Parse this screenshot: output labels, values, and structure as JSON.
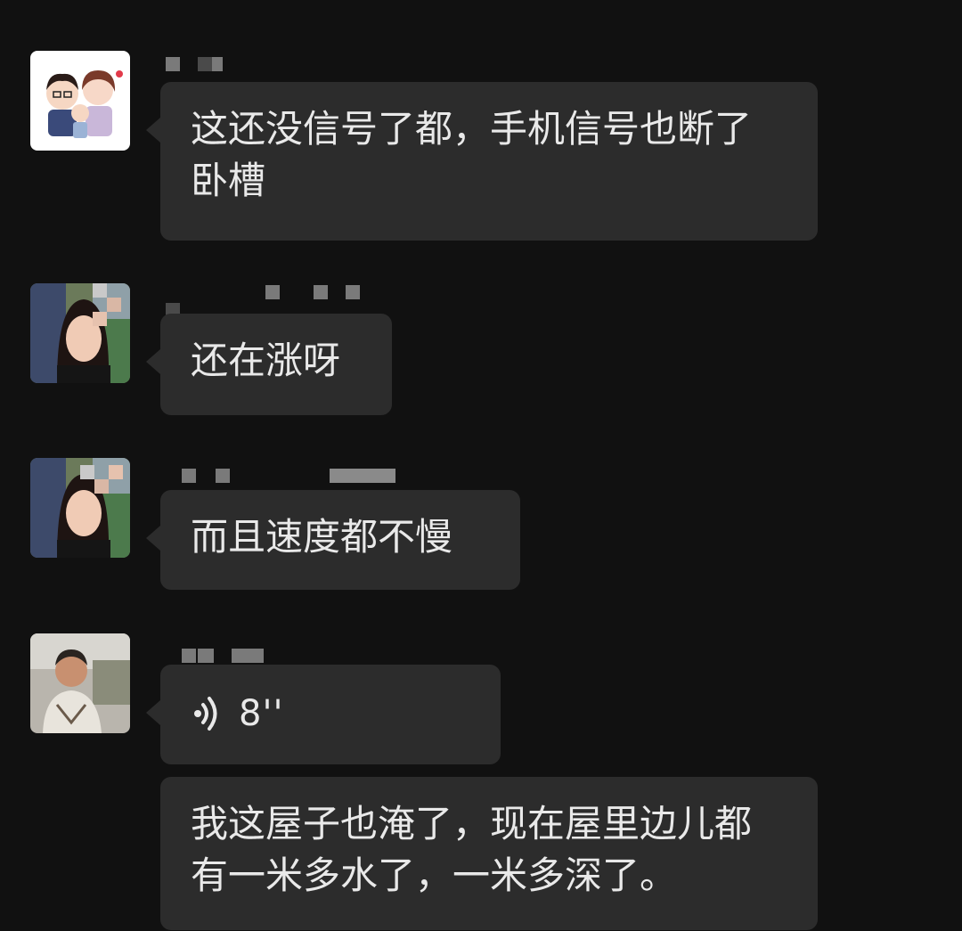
{
  "messages": [
    {
      "type": "text",
      "text": "这还没信号了都，手机信号也断了卧槽",
      "avatar": "cartoon-couple-avatar"
    },
    {
      "type": "text",
      "text": "还在涨呀",
      "avatar": "woman-photo-avatar"
    },
    {
      "type": "text",
      "text": "而且速度都不慢",
      "avatar": "woman-photo-avatar"
    },
    {
      "type": "voice",
      "duration": "8''",
      "avatar": "man-photo-avatar"
    },
    {
      "type": "text",
      "text": "我这屋子也淹了，现在屋里边儿都有一米多水了，一米多深了。",
      "avatar": "man-photo-avatar"
    }
  ],
  "colors": {
    "background": "#111111",
    "bubble": "#2c2c2c",
    "text": "#e9e9e9"
  }
}
